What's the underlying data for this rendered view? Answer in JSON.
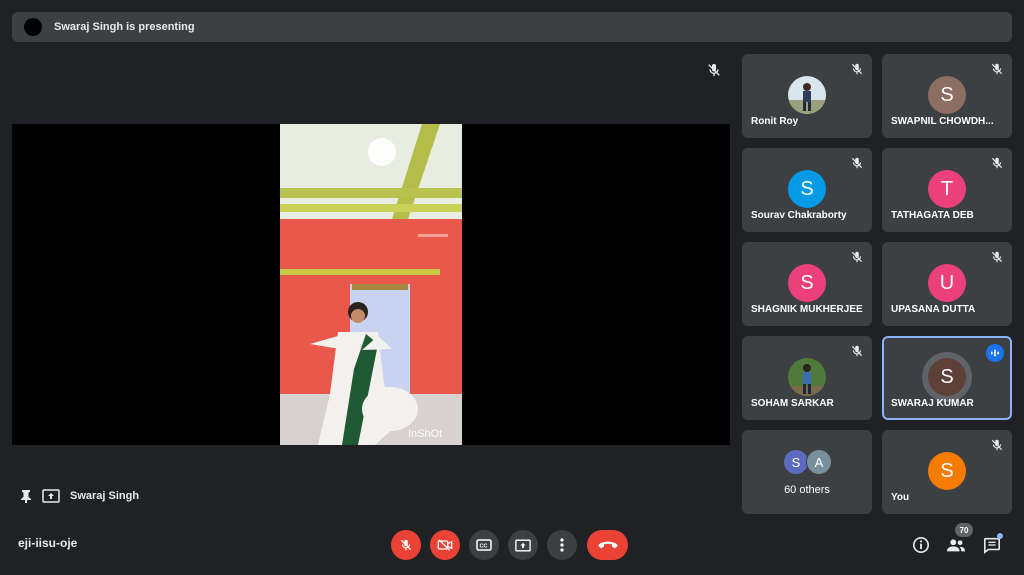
{
  "banner": {
    "text": "Swaraj Singh is presenting"
  },
  "stage": {
    "watermark": "InShOt"
  },
  "presenter": {
    "name": "Swaraj Singh"
  },
  "participants": [
    {
      "name": "Ronit Roy",
      "initial": "",
      "muted": true
    },
    {
      "name": "SWAPNIL CHOWDH...",
      "initial": "S",
      "color": "#8d6e63",
      "muted": true
    },
    {
      "name": "Sourav Chakraborty",
      "initial": "S",
      "color": "#039be5",
      "muted": true
    },
    {
      "name": "TATHAGATA DEB",
      "initial": "T",
      "color": "#ec407a",
      "muted": true
    },
    {
      "name": "SHAGNIK MUKHERJEE",
      "initial": "S",
      "color": "#ec407a",
      "muted": true
    },
    {
      "name": "UPASANA DUTTA",
      "initial": "U",
      "color": "#ec407a",
      "muted": true
    },
    {
      "name": "SOHAM SARKAR",
      "initial": "",
      "muted": true
    },
    {
      "name": "SWARAJ KUMAR",
      "initial": "S",
      "color": "#5d4037",
      "speaking": true
    },
    {
      "name": "You",
      "initial": "S",
      "color": "#f57c00",
      "muted": true
    }
  ],
  "others": {
    "label": "60 others",
    "avatars": [
      {
        "initial": "S",
        "color": "#5c6bc0"
      },
      {
        "initial": "A",
        "color": "#78909c"
      }
    ]
  },
  "bottom_bar": {
    "meeting_code": "eji-iisu-oje",
    "participant_count": "70",
    "icons": [
      "mic-off-icon",
      "camera-off-icon",
      "captions-icon",
      "present-icon",
      "more-icon",
      "end-call-icon",
      "info-icon",
      "people-icon",
      "chat-icon"
    ]
  }
}
